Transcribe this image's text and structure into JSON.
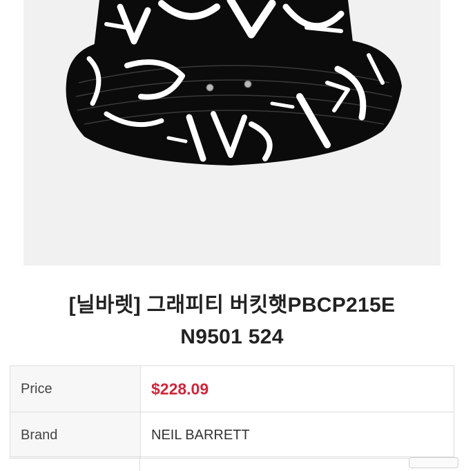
{
  "product": {
    "title_line1": "[닐바렛] 그래피티 버킷햇PBCP215E",
    "title_line2": "N9501 524"
  },
  "specs": {
    "price_label": "Price",
    "price_value": "$228.09",
    "brand_label": "Brand",
    "brand_value": "NEIL BARRETT"
  },
  "colors": {
    "price": "#d0263a",
    "hat": "#0b0b0b",
    "graffiti": "#ffffff"
  }
}
